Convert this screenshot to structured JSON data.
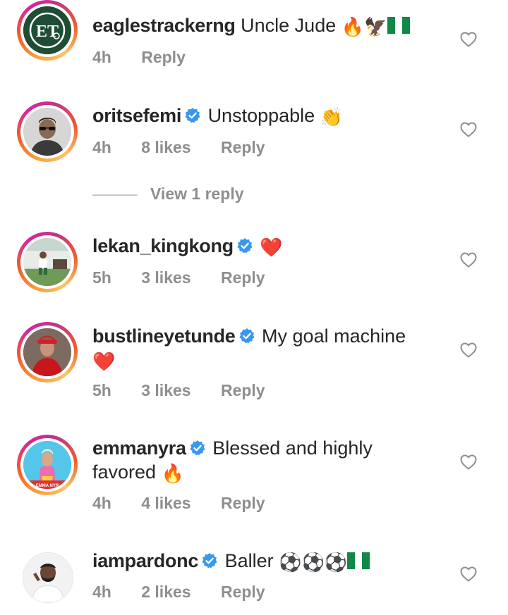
{
  "comments": [
    {
      "username": "eaglestrackerng",
      "verified": false,
      "text": "Uncle Jude",
      "emojis": [
        "🔥",
        "🦅"
      ],
      "flag": "nigeria-flag",
      "time": "4h",
      "likes": "",
      "reply_label": "Reply",
      "avatar": "et-logo-avatar"
    },
    {
      "username": "oritsefemi",
      "verified": true,
      "text": "Unstoppable",
      "emojis": [
        "👏"
      ],
      "time": "4h",
      "likes": "8 likes",
      "reply_label": "Reply",
      "avatar": "man-with-sunglasses-avatar"
    },
    {
      "username": "lekan_kingkong",
      "verified": true,
      "text": "",
      "emojis": [
        "❤️"
      ],
      "time": "5h",
      "likes": "3 likes",
      "reply_label": "Reply",
      "avatar": "man-on-lawn-avatar"
    },
    {
      "username": "bustlineyetunde",
      "verified": true,
      "text": "My goal machine",
      "emojis": [
        "❤️"
      ],
      "time": "5h",
      "likes": "3 likes",
      "reply_label": "Reply",
      "avatar": "woman-in-red-avatar"
    },
    {
      "username": "emmanyra",
      "verified": true,
      "text": "Blessed and highly",
      "text_line2": "favored",
      "emojis": [
        "🔥"
      ],
      "avatar_caption": "EMMA NYR",
      "time": "4h",
      "likes": "4 likes",
      "reply_label": "Reply",
      "avatar": "woman-colorful-outfit-avatar"
    },
    {
      "username": "iampardonc",
      "verified": true,
      "text": "Baller",
      "emojis": [
        "⚽",
        "⚽",
        "⚽"
      ],
      "flag": "nigeria-flag",
      "time": "4h",
      "likes": "2 likes",
      "reply_label": "Reply",
      "avatar": "bearded-man-avatar"
    }
  ],
  "view_replies": {
    "label": "View 1 reply"
  },
  "avatar_logo_text": "ET",
  "colors": {
    "username": "#262626",
    "meta": "#8e8e8e",
    "verified": "#3897f0",
    "heart": "#8e8e8e",
    "emoji_heart": "#e0242f",
    "story_ring_start": "#f9a03f",
    "story_ring_end": "#c13584"
  }
}
